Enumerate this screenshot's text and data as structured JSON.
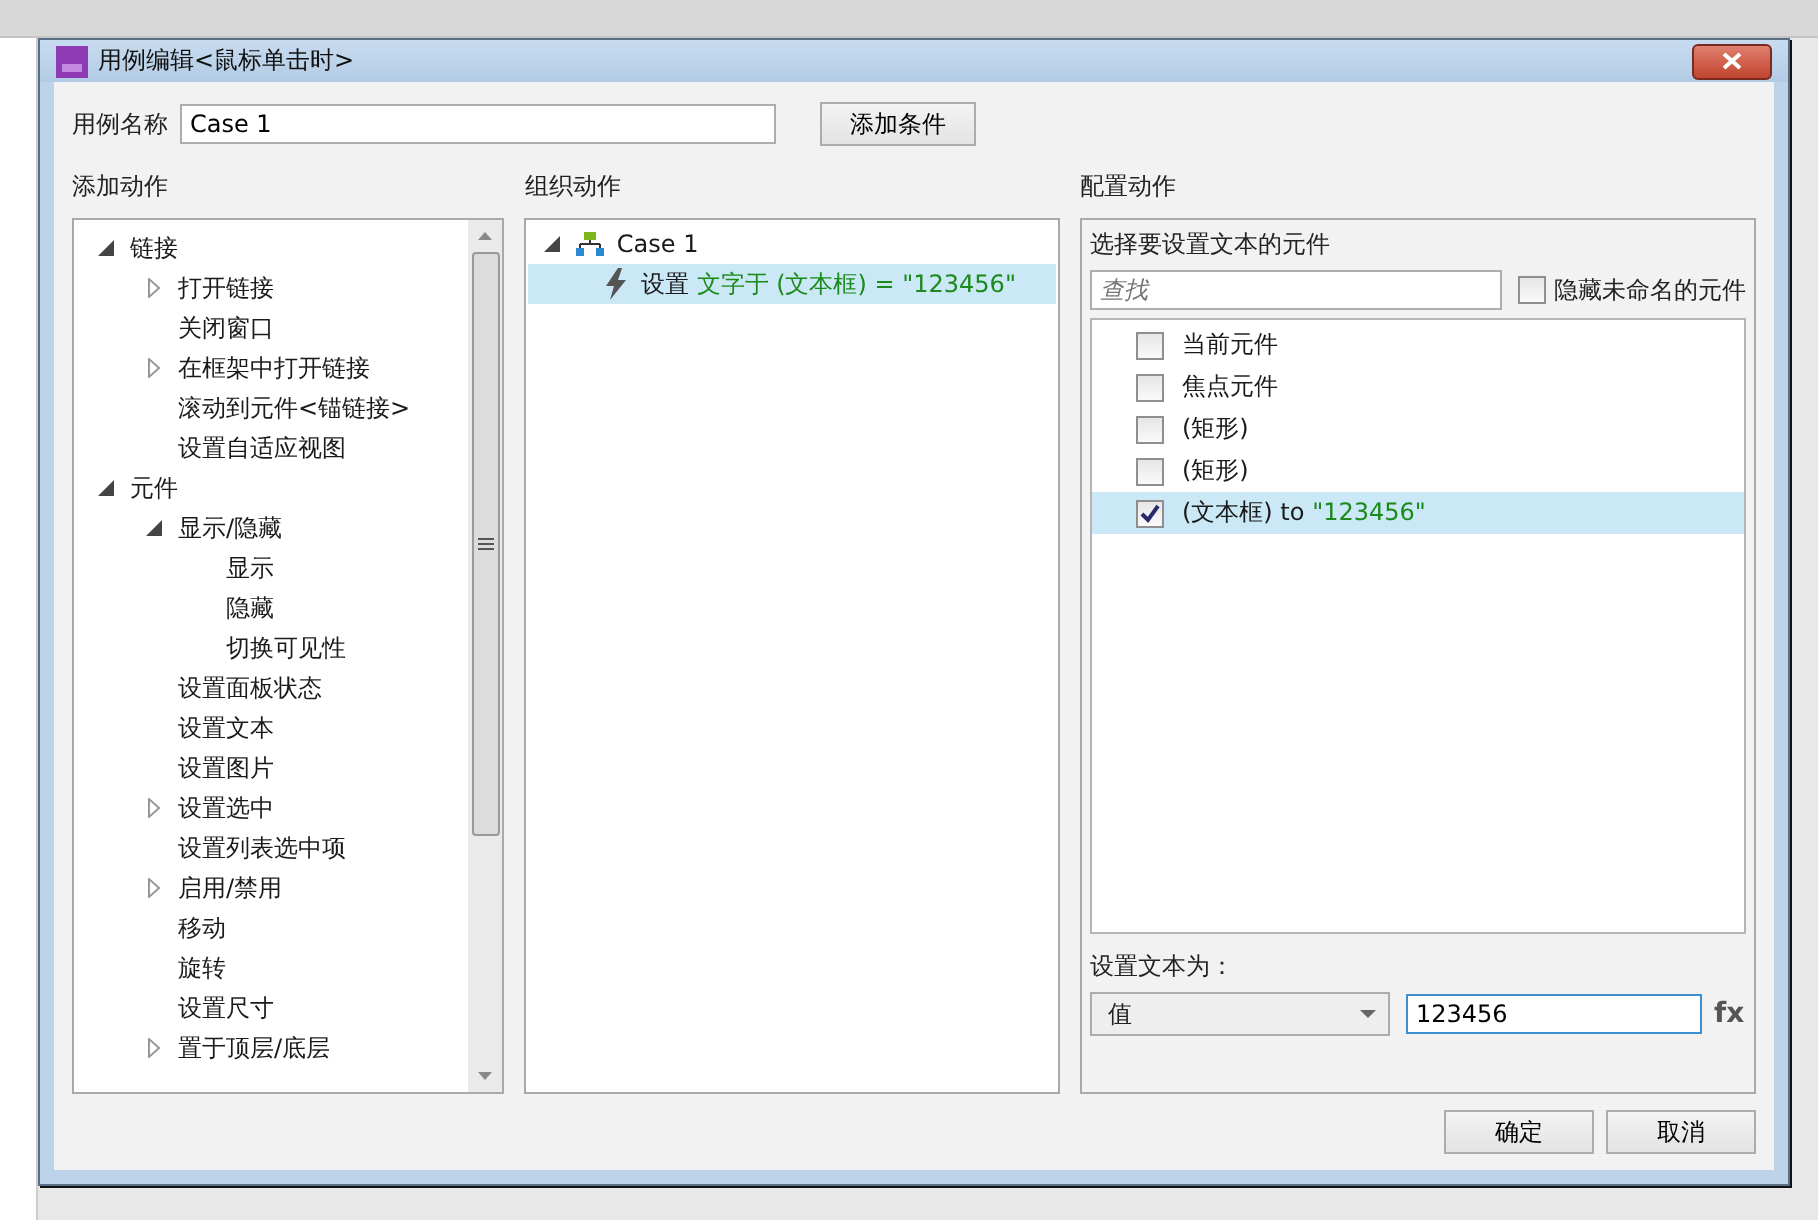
{
  "window": {
    "title": "用例编辑<鼠标单击时>"
  },
  "case_name": {
    "label": "用例名称",
    "value": "Case 1"
  },
  "add_condition_button": "添加条件",
  "add_action": {
    "heading": "添加动作",
    "tree": [
      {
        "label": "链接",
        "expanded": true,
        "children": [
          {
            "label": "打开链接",
            "expanded": false
          },
          {
            "label": "关闭窗口"
          },
          {
            "label": "在框架中打开链接",
            "expanded": false
          },
          {
            "label": "滚动到元件<锚链接>"
          },
          {
            "label": "设置自适应视图"
          }
        ]
      },
      {
        "label": "元件",
        "expanded": true,
        "children": [
          {
            "label": "显示/隐藏",
            "expanded": true,
            "children": [
              {
                "label": "显示"
              },
              {
                "label": "隐藏"
              },
              {
                "label": "切换可见性"
              }
            ]
          },
          {
            "label": "设置面板状态"
          },
          {
            "label": "设置文本"
          },
          {
            "label": "设置图片"
          },
          {
            "label": "设置选中",
            "expanded": false
          },
          {
            "label": "设置列表选中项"
          },
          {
            "label": "启用/禁用",
            "expanded": false
          },
          {
            "label": "移动"
          },
          {
            "label": "旋转"
          },
          {
            "label": "设置尺寸"
          },
          {
            "label": "置于顶层/底层",
            "expanded": false
          }
        ]
      }
    ]
  },
  "organize_actions": {
    "heading": "组织动作",
    "case": {
      "label": "Case 1",
      "expanded": true,
      "actions": [
        {
          "verb": "设置",
          "detail": "文字于 (文本框) = \"123456\"",
          "selected": true
        }
      ]
    }
  },
  "configure_action": {
    "heading": "配置动作",
    "subheading": "选择要设置文本的元件",
    "search": {
      "placeholder": "查找"
    },
    "hide_unnamed": {
      "label": "隐藏未命名的元件",
      "checked": false
    },
    "widgets": [
      {
        "label": "当前元件",
        "checked": false,
        "selected": false
      },
      {
        "label": "焦点元件",
        "checked": false,
        "selected": false
      },
      {
        "label": "(矩形)",
        "checked": false,
        "selected": false
      },
      {
        "label": "(矩形)",
        "checked": false,
        "selected": false
      },
      {
        "label": "(文本框) to",
        "value": "\"123456\"",
        "checked": true,
        "selected": true
      }
    ],
    "set_text_label": "设置文本为：",
    "value_type": "值",
    "value": "123456",
    "fx": "fx"
  },
  "buttons": [
    "确定",
    "取消"
  ]
}
